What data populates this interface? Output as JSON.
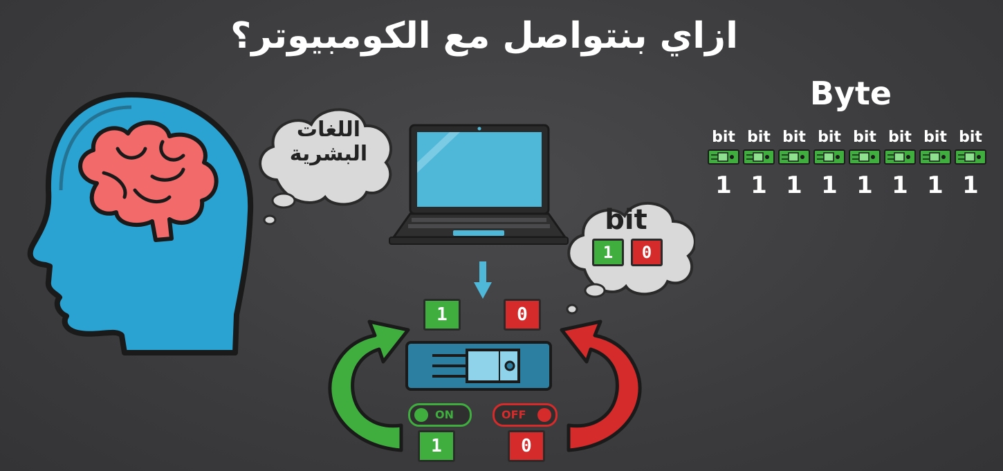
{
  "title": "ازاي بنتواصل مع الكومبيوتر؟",
  "brain_cloud": {
    "line1": "اللغات",
    "line2": "البشرية"
  },
  "bit_cloud": {
    "label": "bit",
    "one": "1",
    "zero": "0"
  },
  "switch_panel": {
    "top_one": "1",
    "top_zero": "0",
    "on_label": "ON",
    "off_label": "OFF",
    "bottom_one": "1",
    "bottom_zero": "0"
  },
  "byte": {
    "title": "Byte",
    "bits": [
      {
        "label": "bit",
        "value": "1"
      },
      {
        "label": "bit",
        "value": "1"
      },
      {
        "label": "bit",
        "value": "1"
      },
      {
        "label": "bit",
        "value": "1"
      },
      {
        "label": "bit",
        "value": "1"
      },
      {
        "label": "bit",
        "value": "1"
      },
      {
        "label": "bit",
        "value": "1"
      },
      {
        "label": "bit",
        "value": "1"
      }
    ]
  },
  "colors": {
    "green": "#3fae3f",
    "red": "#d62b2b",
    "head_blue": "#2aa3d3",
    "brain": "#f26a6a"
  },
  "icons": [
    "head-icon",
    "brain-icon",
    "laptop-icon",
    "transistor-icon",
    "green-arrow-icon",
    "red-arrow-icon",
    "chip-icon"
  ]
}
